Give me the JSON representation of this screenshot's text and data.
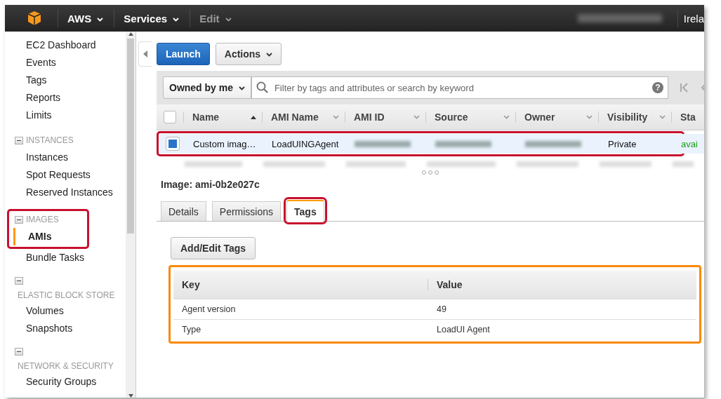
{
  "topbar": {
    "menus": [
      {
        "label": "AWS",
        "disabled": false
      },
      {
        "label": "Services",
        "disabled": false
      },
      {
        "label": "Edit",
        "disabled": true
      }
    ],
    "region": "Irela"
  },
  "sidebar": {
    "sections": [
      {
        "kind": "plain",
        "items": [
          {
            "label": "EC2 Dashboard",
            "selected": false
          },
          {
            "label": "Events",
            "selected": false
          },
          {
            "label": "Tags",
            "selected": false
          },
          {
            "label": "Reports",
            "selected": false
          },
          {
            "label": "Limits",
            "selected": false
          }
        ]
      },
      {
        "kind": "inline",
        "header": "INSTANCES",
        "items": [
          {
            "label": "Instances",
            "selected": false
          },
          {
            "label": "Spot Requests",
            "selected": false
          },
          {
            "label": "Reserved Instances",
            "selected": false
          }
        ]
      },
      {
        "kind": "inline",
        "header": "IMAGES",
        "highlighted": true,
        "items": [
          {
            "label": "AMIs",
            "selected": true
          },
          {
            "label": "Bundle Tasks",
            "selected": false
          }
        ]
      },
      {
        "kind": "below",
        "header": "ELASTIC BLOCK STORE",
        "items": [
          {
            "label": "Volumes",
            "selected": false
          },
          {
            "label": "Snapshots",
            "selected": false
          }
        ]
      },
      {
        "kind": "below",
        "header": "NETWORK & SECURITY",
        "items": [
          {
            "label": "Security Groups",
            "selected": false
          }
        ]
      }
    ]
  },
  "toolbar": {
    "primary": "Launch",
    "actions": "Actions"
  },
  "filter": {
    "owner": "Owned by me",
    "placeholder": "Filter by tags and attributes or search by keyword",
    "help": "?"
  },
  "table": {
    "select_all_checked": false,
    "columns": [
      {
        "label": "Name",
        "sorted": true
      },
      {
        "label": "AMI Name",
        "sorted": false
      },
      {
        "label": "AMI ID",
        "sorted": false
      },
      {
        "label": "Source",
        "sorted": false
      },
      {
        "label": "Owner",
        "sorted": false
      },
      {
        "label": "Visibility",
        "sorted": false
      },
      {
        "label": "Sta"
      }
    ],
    "rows": [
      {
        "kind": "visible",
        "selected": true,
        "highlighted": true,
        "cells": [
          {
            "kind": "text",
            "text": "Custom imag…"
          },
          {
            "kind": "text",
            "text": "LoadUINGAgent"
          },
          {
            "kind": "blurred"
          },
          {
            "kind": "blurred"
          },
          {
            "kind": "blurred"
          },
          {
            "kind": "text",
            "text": "Private"
          },
          {
            "kind": "status",
            "text": "avai"
          }
        ]
      },
      {
        "kind": "blurred"
      }
    ]
  },
  "detail": {
    "title": "Image: ami-0b2e027c",
    "tabs": [
      {
        "label": "Details",
        "selected": false,
        "highlighted": false
      },
      {
        "label": "Permissions",
        "selected": false,
        "highlighted": false
      },
      {
        "label": "Tags",
        "selected": true,
        "highlighted": true
      }
    ],
    "button": "Add/Edit Tags",
    "tags": {
      "highlighted": true,
      "columns": [
        "Key",
        "Value"
      ],
      "rows": [
        [
          "Agent version",
          "49"
        ],
        [
          "Type",
          "LoadUI Agent"
        ]
      ]
    }
  }
}
